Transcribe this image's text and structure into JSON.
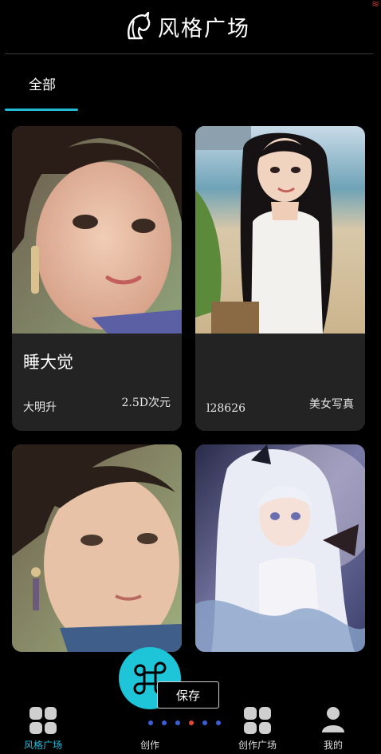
{
  "header": {
    "title": "风格广场",
    "logo_icon": "horse-head-icon",
    "corner_mark": "≋"
  },
  "tabs": [
    {
      "label": "全部",
      "active": true
    }
  ],
  "accent_color": "#22b8d6",
  "cards": [
    {
      "name": "睡大觉",
      "author": "大明升",
      "style": "2.5D次元"
    },
    {
      "name": "",
      "author": "l28626",
      "style": "美女写真"
    },
    {
      "name": "",
      "author": "",
      "style": ""
    },
    {
      "name": "",
      "author": "",
      "style": ""
    }
  ],
  "fab": {
    "icon": "command-icon"
  },
  "save_label": "保存",
  "carousel": {
    "count": 6,
    "active_index": 3
  },
  "bottom_nav": [
    {
      "label": "风格广场",
      "icon": "grid-icon",
      "active": true
    },
    {
      "label": "创作",
      "icon": "command-icon",
      "active": false
    },
    {
      "label": "创作广场",
      "icon": "grid-icon",
      "active": false
    },
    {
      "label": "我的",
      "icon": "user-icon",
      "active": false
    }
  ]
}
